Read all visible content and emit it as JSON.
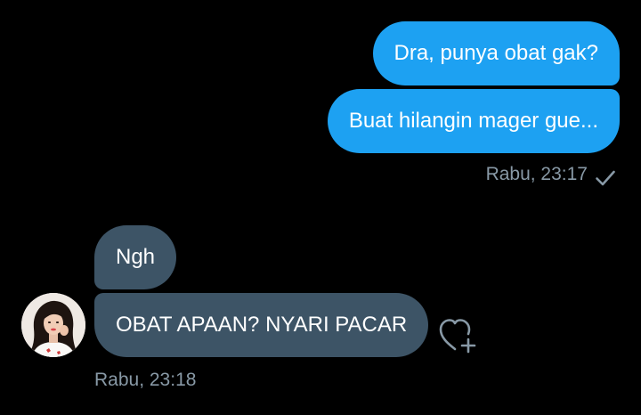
{
  "conversation": {
    "sent": [
      {
        "text": "Dra, punya obat gak?"
      },
      {
        "text": "Buat hilangin mager gue..."
      }
    ],
    "sent_timestamp": "Rabu, 23:17",
    "received": [
      {
        "text": "Ngh"
      },
      {
        "text": "OBAT APAAN? NYARI PACAR"
      }
    ],
    "received_timestamp": "Rabu, 23:18"
  },
  "icons": {
    "read_receipt": "checkmark-icon",
    "like": "heart-plus-icon",
    "avatar": "user-avatar"
  },
  "colors": {
    "background": "#000000",
    "sent_bubble": "#1da1f2",
    "received_bubble": "#3d5466",
    "meta_text": "#8899a6",
    "message_text": "#ffffff"
  }
}
